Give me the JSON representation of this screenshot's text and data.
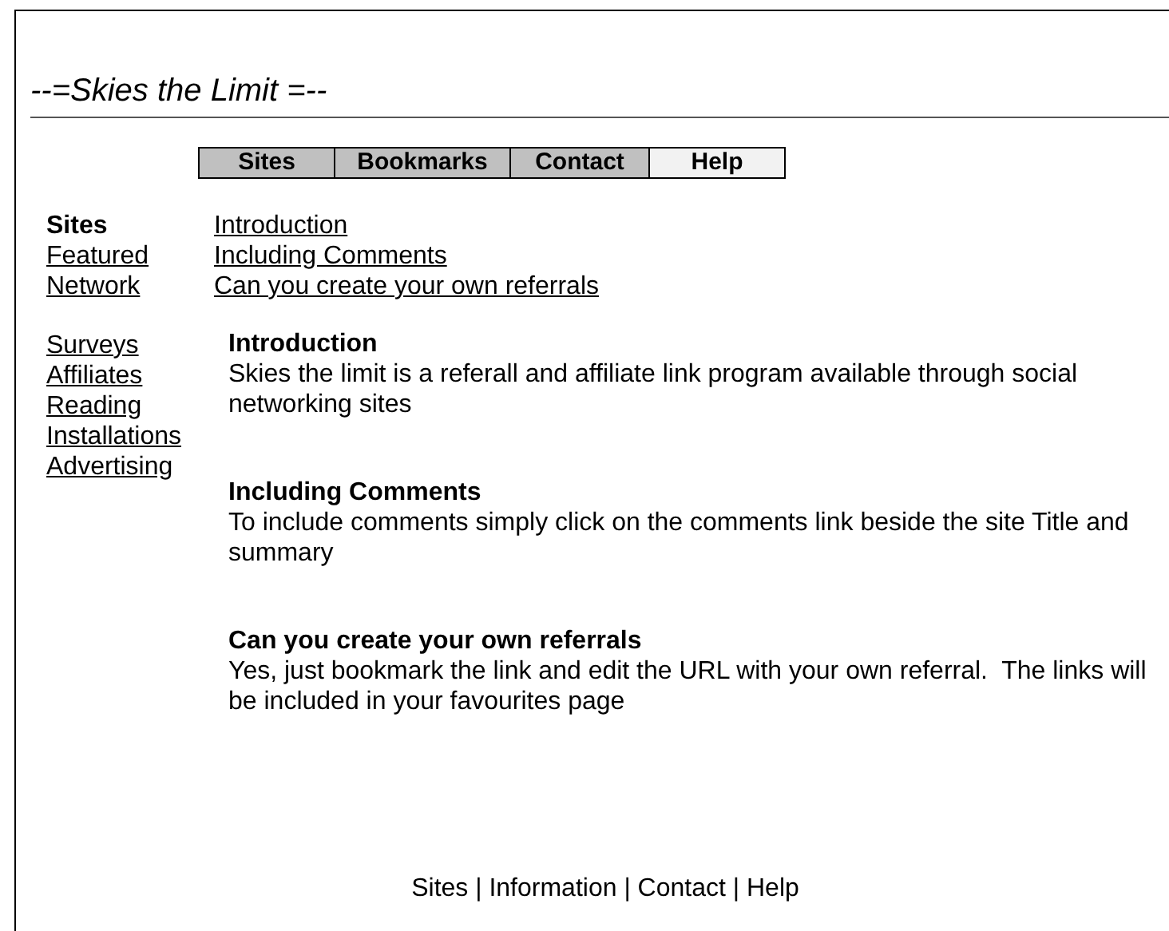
{
  "title": "--=Skies the Limit =--",
  "tabs": [
    {
      "label": "Sites",
      "selected": false
    },
    {
      "label": "Bookmarks",
      "selected": false
    },
    {
      "label": "Contact",
      "selected": false
    },
    {
      "label": "Help",
      "selected": true
    }
  ],
  "sidebar": {
    "groups": [
      [
        {
          "kind": "heading",
          "label": "Sites"
        },
        {
          "kind": "link",
          "label": "Featured"
        },
        {
          "kind": "link",
          "label": "Network"
        }
      ],
      [
        {
          "kind": "link",
          "label": "Surveys"
        },
        {
          "kind": "link",
          "label": "Affiliates"
        },
        {
          "kind": "link",
          "label": "Reading"
        },
        {
          "kind": "link",
          "label": "Installations"
        },
        {
          "kind": "link",
          "label": "Advertising"
        }
      ]
    ]
  },
  "toc": [
    "Introduction",
    "Including Comments",
    "Can you create your own referrals"
  ],
  "sections": [
    {
      "heading": "Introduction",
      "body": "Skies the limit is a referall and affiliate link program available through social networking sites"
    },
    {
      "heading": "Including Comments",
      "body": "To include comments simply click on the comments link beside the site Title and summary"
    },
    {
      "heading": "Can you create your own referrals",
      "body": "Yes, just bookmark the link and edit the URL with your own referral.  The links will be included in your favourites page"
    }
  ],
  "footer": "Sites | Information | Contact | Help"
}
